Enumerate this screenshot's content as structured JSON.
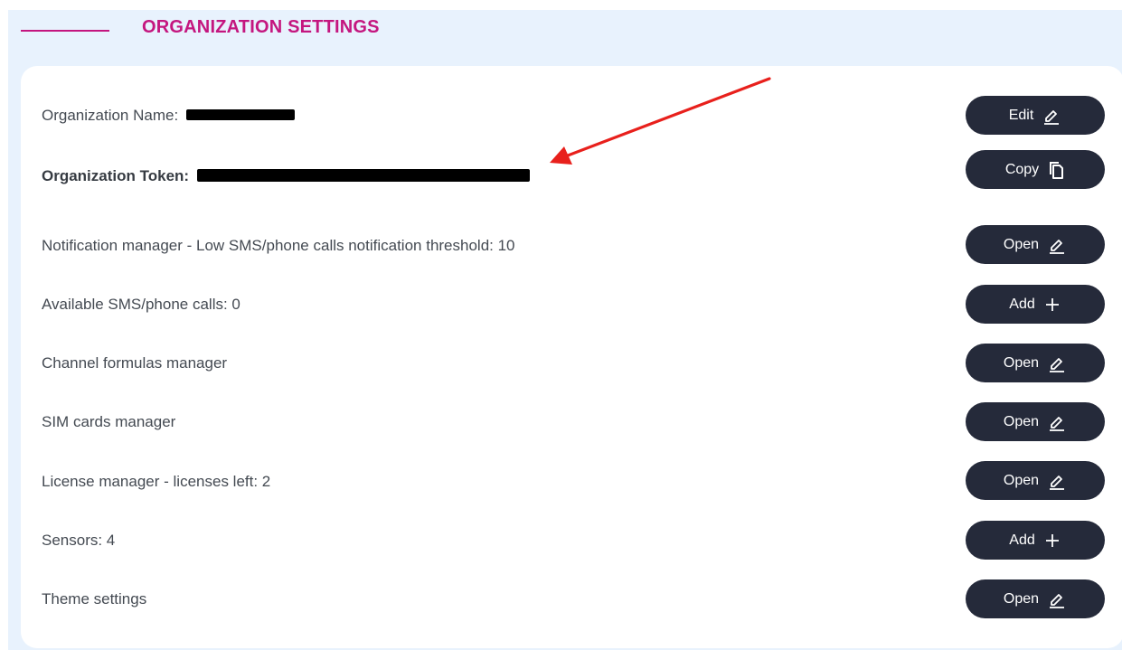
{
  "header": {
    "title": "ORGANIZATION SETTINGS"
  },
  "rows": [
    {
      "label": "Organization Name:",
      "button": "Edit",
      "icon": "pencil-icon"
    },
    {
      "label": "Organization Token:",
      "button": "Copy",
      "icon": "copy-icon"
    },
    {
      "label": "Notification manager - Low SMS/phone calls notification threshold: 10",
      "button": "Open",
      "icon": "pencil-icon"
    },
    {
      "label": "Available SMS/phone calls: 0",
      "button": "Add",
      "icon": "plus-icon"
    },
    {
      "label": "Channel formulas manager",
      "button": "Open",
      "icon": "pencil-icon"
    },
    {
      "label": "SIM cards manager",
      "button": "Open",
      "icon": "pencil-icon"
    },
    {
      "label": "License manager - licenses left: 2",
      "button": "Open",
      "icon": "pencil-icon"
    },
    {
      "label": "Sensors: 4",
      "button": "Add",
      "icon": "plus-icon"
    },
    {
      "label": "Theme settings",
      "button": "Open",
      "icon": "pencil-icon"
    }
  ],
  "colors": {
    "accent": "#c4167f",
    "button_bg": "#252a3a",
    "panel_bg": "#e8f2fd",
    "annotation_arrow": "#e8201c"
  }
}
